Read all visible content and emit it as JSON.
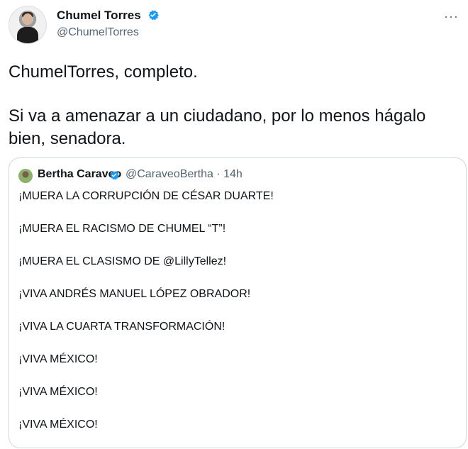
{
  "tweet": {
    "author": {
      "name": "Chumel Torres",
      "handle": "@ChumelTorres"
    },
    "more_label": "···",
    "text_lines": [
      "ChumelTorres, completo.",
      "Si va a amenazar a un ciudadano, por lo menos hágalo bien, senadora."
    ]
  },
  "quote": {
    "author": {
      "name": "Bertha Caraveo",
      "handle": "@CaraveoBertha",
      "time": "· 14h"
    },
    "lines": [
      "¡MUERA LA CORRUPCIÓN DE CÉSAR DUARTE!",
      "¡MUERA EL RACISMO DE CHUMEL “T”!",
      "¡MUERA EL CLASISMO DE @LillyTellez!",
      "¡VIVA ANDRÉS MANUEL LÓPEZ OBRADOR!",
      "¡VIVA LA CUARTA TRANSFORMACIÓN!",
      "¡VIVA MÉXICO!",
      "¡VIVA MÉXICO!",
      "¡VIVA MÉXICO!"
    ]
  },
  "colors": {
    "text_primary": "#0f1419",
    "text_secondary": "#536471",
    "verified_blue": "#1d9bf0",
    "border": "#cfd9de"
  },
  "icons": {
    "verified": "verified-badge-icon",
    "more": "more-options-icon"
  }
}
